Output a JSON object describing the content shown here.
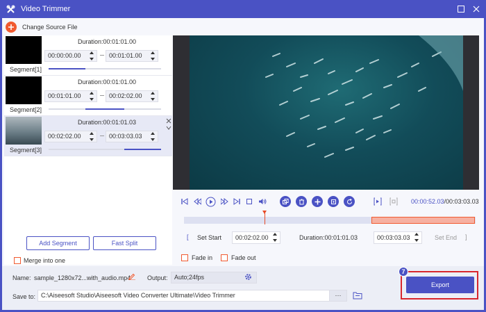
{
  "window": {
    "title": "Video Trimmer"
  },
  "toolbar": {
    "change_source_label": "Change Source File"
  },
  "segments": [
    {
      "label": "Segment[1]",
      "duration": "Duration:00:01:01.00",
      "start": "00:00:00.00",
      "end": "00:01:01.00",
      "progress_start": 0.0,
      "progress_end": 0.33
    },
    {
      "label": "Segment[2]",
      "duration": "Duration:00:01:01.00",
      "start": "00:01:01.00",
      "end": "00:02:02.00",
      "progress_start": 0.33,
      "progress_end": 0.67
    },
    {
      "label": "Segment[3]",
      "duration": "Duration:00:01:01.03",
      "start": "00:02:02.00",
      "end": "00:03:03.03",
      "progress_start": 0.67,
      "progress_end": 1.0
    }
  ],
  "actions": {
    "add_segment": "Add Segment",
    "fast_split": "Fast Split",
    "merge_label": "Merge into one"
  },
  "player": {
    "current_time": "00:00:52.03",
    "total_time": "/00:03:03.03"
  },
  "trim": {
    "set_start_label": "Set Start",
    "start_value": "00:02:02.00",
    "duration": "Duration:00:01:01.03",
    "end_value": "00:03:03.03",
    "set_end_label": "Set End"
  },
  "fade": {
    "fade_in": "Fade in",
    "fade_out": "Fade out"
  },
  "output": {
    "name_label": "Name:",
    "name_value": "sample_1280x72...with_audio.mp4",
    "output_label": "Output:",
    "output_value": "Auto;24fps",
    "save_label": "Save to:",
    "save_path": "C:\\Aiseesoft Studio\\Aiseesoft Video Converter Ultimate\\Video Trimmer",
    "browse_label": "···"
  },
  "export": {
    "label": "Export",
    "step_badge": "7"
  },
  "colors": {
    "accent": "#4a52c4",
    "orange": "#f15a30",
    "highlight": "#d8262d"
  }
}
